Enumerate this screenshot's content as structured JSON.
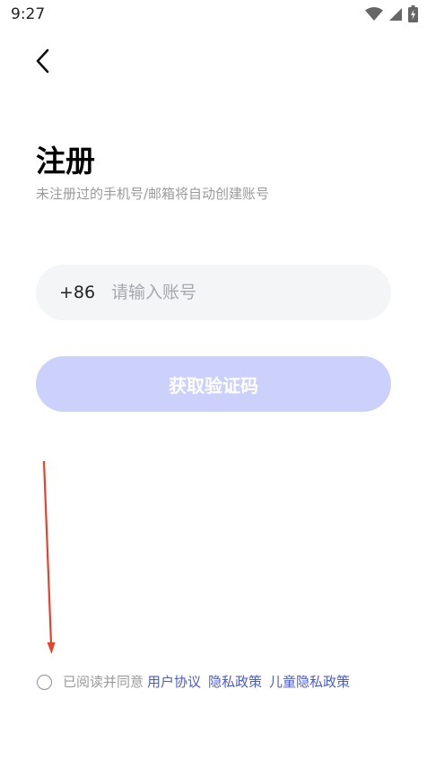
{
  "status_bar": {
    "time": "9:27",
    "icons": [
      "wifi-icon",
      "signal-icon",
      "battery-charging-icon"
    ]
  },
  "header": {
    "back_icon": "chevron-left-icon"
  },
  "register": {
    "title": "注册",
    "subtitle": "未注册过的手机号/邮箱将自动创建账号"
  },
  "phone_input": {
    "country_code": "+86",
    "value": "",
    "placeholder": "请输入账号"
  },
  "get_code_button": {
    "label": "获取验证码",
    "color": "#cbd1fb"
  },
  "agreement": {
    "checked": false,
    "prefix": "已阅读并同意",
    "links": [
      "用户协议",
      "隐私政策",
      "儿童隐私政策"
    ],
    "link_color": "#4a5bd8"
  },
  "annotation": {
    "arrow_color": "#e5432c"
  }
}
